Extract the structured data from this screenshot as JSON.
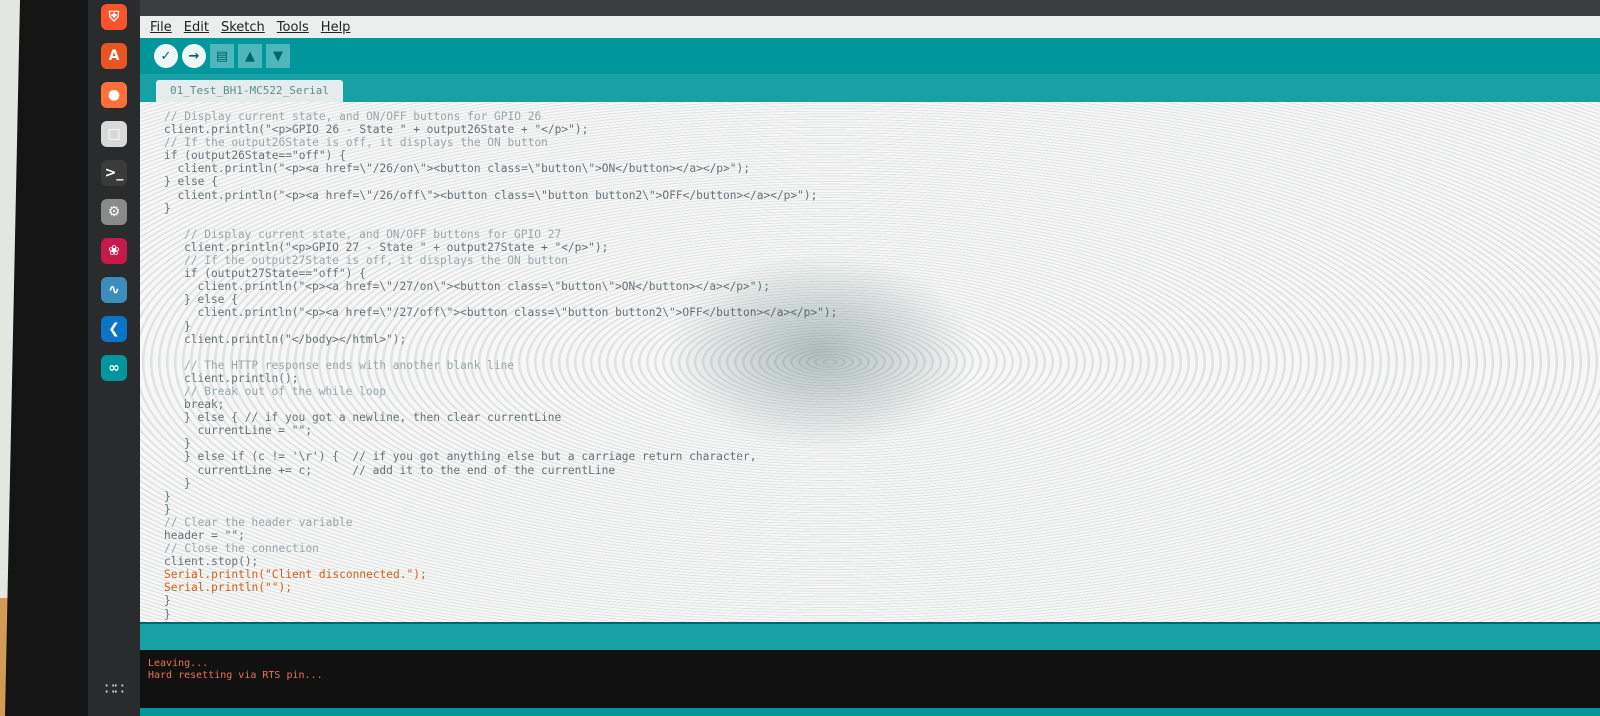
{
  "menu": [
    "File",
    "Edit",
    "Sketch",
    "Tools",
    "Help"
  ],
  "toolbar": {
    "verify_icon": "checkmark-icon",
    "upload_icon": "right-arrow-icon",
    "new_icon": "new-file-icon",
    "open_icon": "open-file-icon",
    "save_icon": "save-icon"
  },
  "tab": {
    "label": "01_Test_BH1-MC522_Serial"
  },
  "dock": [
    {
      "name": "brave-browser-icon",
      "color": "#fb542b",
      "glyph": "⛨"
    },
    {
      "name": "app-center-icon",
      "color": "#e95420",
      "glyph": "A"
    },
    {
      "name": "firefox-icon",
      "color": "#ff7139",
      "glyph": "●"
    },
    {
      "name": "files-icon",
      "color": "#d9d9d9",
      "glyph": "□"
    },
    {
      "name": "terminal-icon",
      "color": "#3b3b3b",
      "glyph": ">_"
    },
    {
      "name": "settings-icon",
      "color": "#8a8a8a",
      "glyph": "⚙"
    },
    {
      "name": "raspberry-pi-icon",
      "color": "#c51a4a",
      "glyph": "❀"
    },
    {
      "name": "system-monitor-icon",
      "color": "#3c8dbc",
      "glyph": "∿"
    },
    {
      "name": "vscode-icon",
      "color": "#0a74c6",
      "glyph": "❮"
    },
    {
      "name": "arduino-icon",
      "color": "#00979c",
      "glyph": "∞"
    }
  ],
  "code": [
    {
      "t": "// Display current state, and ON/OFF buttons for GPIO 26",
      "k": "cm",
      "i": 0
    },
    {
      "t": "client.println(\"<p>GPIO 26 - State \" + output26State + \"</p>\");",
      "k": "",
      "i": 0
    },
    {
      "t": "// If the output26State is off, it displays the ON button",
      "k": "cm",
      "i": 0
    },
    {
      "t": "if (output26State==\"off\") {",
      "k": "",
      "i": 0
    },
    {
      "t": "  client.println(\"<p><a href=\\\"/26/on\\\"><button class=\\\"button\\\">ON</button></a></p>\");",
      "k": "",
      "i": 0
    },
    {
      "t": "} else {",
      "k": "",
      "i": 0
    },
    {
      "t": "  client.println(\"<p><a href=\\\"/26/off\\\"><button class=\\\"button button2\\\">OFF</button></a></p>\");",
      "k": "",
      "i": 0
    },
    {
      "t": "}",
      "k": "",
      "i": 0
    },
    {
      "t": "",
      "k": "",
      "i": 0
    },
    {
      "t": "// Display current state, and ON/OFF buttons for GPIO 27",
      "k": "cm",
      "i": 1
    },
    {
      "t": "client.println(\"<p>GPIO 27 - State \" + output27State + \"</p>\");",
      "k": "",
      "i": 1
    },
    {
      "t": "// If the output27State is off, it displays the ON button",
      "k": "cm",
      "i": 1
    },
    {
      "t": "if (output27State==\"off\") {",
      "k": "",
      "i": 1
    },
    {
      "t": "  client.println(\"<p><a href=\\\"/27/on\\\"><button class=\\\"button\\\">ON</button></a></p>\");",
      "k": "",
      "i": 1
    },
    {
      "t": "} else {",
      "k": "",
      "i": 1
    },
    {
      "t": "  client.println(\"<p><a href=\\\"/27/off\\\"><button class=\\\"button button2\\\">OFF</button></a></p>\");",
      "k": "",
      "i": 1
    },
    {
      "t": "}",
      "k": "",
      "i": 1
    },
    {
      "t": "client.println(\"</body></html>\");",
      "k": "",
      "i": 1
    },
    {
      "t": "",
      "k": "",
      "i": 1
    },
    {
      "t": "// The HTTP response ends with another blank line",
      "k": "cm",
      "i": 1
    },
    {
      "t": "client.println();",
      "k": "",
      "i": 1
    },
    {
      "t": "// Break out of the while loop",
      "k": "cm",
      "i": 1
    },
    {
      "t": "break;",
      "k": "",
      "i": 1
    },
    {
      "t": "} else { // if you got a newline, then clear currentLine",
      "k": "",
      "i": 1
    },
    {
      "t": "  currentLine = \"\";",
      "k": "",
      "i": 1
    },
    {
      "t": "}",
      "k": "",
      "i": 1
    },
    {
      "t": "} else if (c != '\\r') {  // if you got anything else but a carriage return character,",
      "k": "",
      "i": 1
    },
    {
      "t": "  currentLine += c;      // add it to the end of the currentLine",
      "k": "",
      "i": 1
    },
    {
      "t": "}",
      "k": "",
      "i": 1
    },
    {
      "t": "}",
      "k": "",
      "i": 0
    },
    {
      "t": "}",
      "k": "",
      "i": 0
    },
    {
      "t": "// Clear the header variable",
      "k": "cm",
      "i": 0
    },
    {
      "t": "header = \"\";",
      "k": "",
      "i": 0
    },
    {
      "t": "// Close the connection",
      "k": "cm",
      "i": 0
    },
    {
      "t": "client.stop();",
      "k": "",
      "i": 0
    },
    {
      "t": "Serial.println(\"Client disconnected.\");",
      "k": "kw",
      "i": 0
    },
    {
      "t": "Serial.println(\"\");",
      "k": "kw",
      "i": 0
    },
    {
      "t": "}",
      "k": "",
      "i": 0
    },
    {
      "t": "}",
      "k": "",
      "i": 0
    }
  ],
  "console": [
    "Leaving...",
    "Hard resetting via RTS pin..."
  ]
}
